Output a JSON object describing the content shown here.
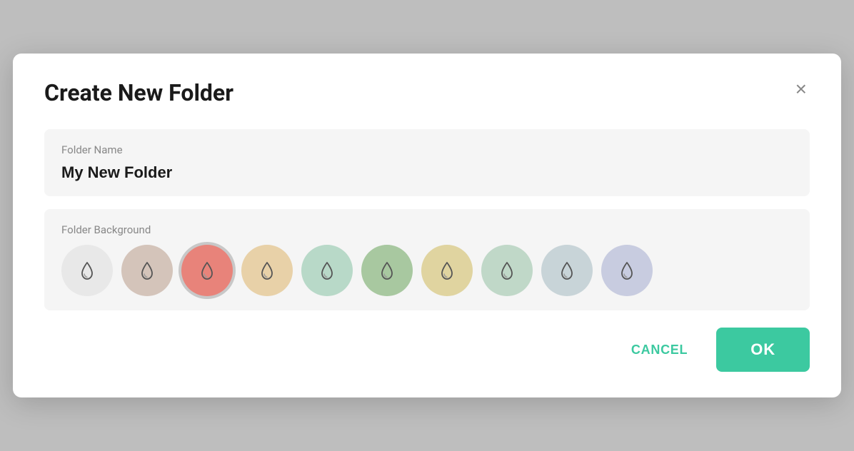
{
  "dialog": {
    "title": "Create New Folder",
    "close_label": "×",
    "folder_name_label": "Folder Name",
    "folder_name_value": "My New Folder",
    "folder_name_placeholder": "My New Folder",
    "bg_label": "Folder Background",
    "cancel_label": "CANCEL",
    "ok_label": "OK"
  },
  "colors": [
    {
      "id": "none",
      "bg": "#e8e8e8",
      "selected": false
    },
    {
      "id": "taupe",
      "bg": "#d4c4ba",
      "selected": false
    },
    {
      "id": "red",
      "bg": "#e8837a",
      "selected": true
    },
    {
      "id": "peach",
      "bg": "#e8d1a8",
      "selected": false
    },
    {
      "id": "mint",
      "bg": "#b8d9c8",
      "selected": false
    },
    {
      "id": "sage",
      "bg": "#a8c8a0",
      "selected": false
    },
    {
      "id": "yellow",
      "bg": "#e0d4a0",
      "selected": false
    },
    {
      "id": "seafoam",
      "bg": "#c0d8c8",
      "selected": false
    },
    {
      "id": "lightblue",
      "bg": "#c8d4d8",
      "selected": false
    },
    {
      "id": "lavender",
      "bg": "#c8cce0",
      "selected": false
    }
  ],
  "accent_color": "#3cc9a0"
}
